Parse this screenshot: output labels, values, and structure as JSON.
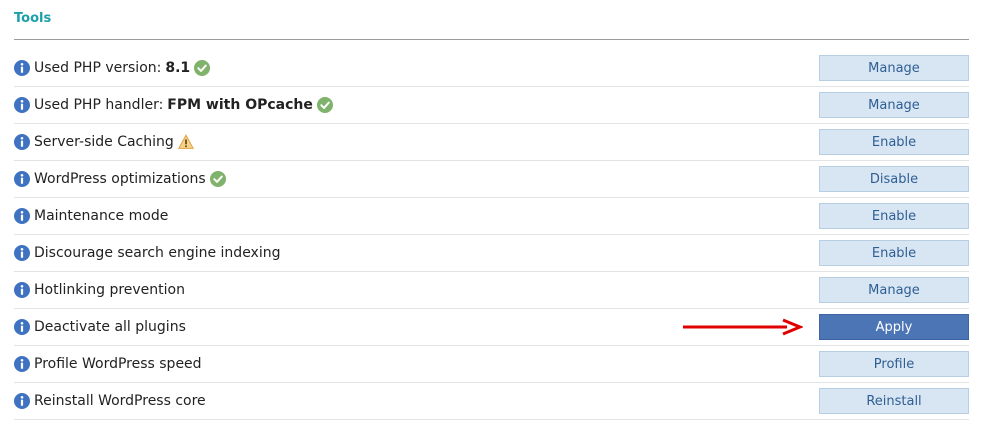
{
  "section": {
    "title": "Tools"
  },
  "rows": [
    {
      "label": "Used PHP version:",
      "value": "8.1",
      "status": "check-icon",
      "button": "Manage"
    },
    {
      "label": "Used PHP handler:",
      "value": "FPM with OPcache",
      "status": "check-icon",
      "button": "Manage"
    },
    {
      "label": "Server-side Caching",
      "status": "warning-icon",
      "button": "Enable"
    },
    {
      "label": "WordPress optimizations",
      "status": "check-icon",
      "button": "Disable"
    },
    {
      "label": "Maintenance mode",
      "button": "Enable"
    },
    {
      "label": "Discourage search engine indexing",
      "button": "Enable"
    },
    {
      "label": "Hotlinking prevention",
      "button": "Manage"
    },
    {
      "label": "Deactivate all plugins",
      "button": "Apply",
      "highlighted": true
    },
    {
      "label": "Profile WordPress speed",
      "button": "Profile"
    },
    {
      "label": "Reinstall WordPress core",
      "button": "Reinstall"
    }
  ],
  "colors": {
    "title": "#1aa0a8",
    "info_icon": "#3f73c2",
    "check_icon": "#7fb26a",
    "warning_icon": "#e0a23b",
    "button_bg": "#d8e6f4",
    "button_text": "#2f5e92",
    "button_primary_bg": "#4c75b6",
    "annotation_arrow": "#e00000"
  },
  "annotation": {
    "icon": "red-arrow-icon",
    "points_to": "Apply"
  }
}
